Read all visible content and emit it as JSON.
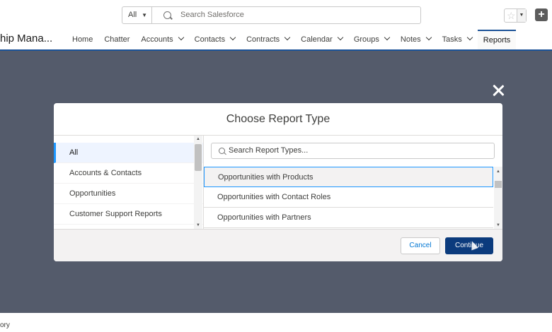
{
  "header": {
    "scope_label": "All",
    "search_placeholder": "Search Salesforce",
    "app_name": "hip Mana...",
    "nav": [
      {
        "label": "Home",
        "has_menu": false
      },
      {
        "label": "Chatter",
        "has_menu": false
      },
      {
        "label": "Accounts",
        "has_menu": true
      },
      {
        "label": "Contacts",
        "has_menu": true
      },
      {
        "label": "Contracts",
        "has_menu": true
      },
      {
        "label": "Calendar",
        "has_menu": true
      },
      {
        "label": "Groups",
        "has_menu": true
      },
      {
        "label": "Notes",
        "has_menu": true
      },
      {
        "label": "Tasks",
        "has_menu": true
      },
      {
        "label": "Reports",
        "has_menu": false
      }
    ]
  },
  "modal": {
    "title": "Choose Report Type",
    "categories": [
      "All",
      "Accounts & Contacts",
      "Opportunities",
      "Customer Support Reports"
    ],
    "search_placeholder": "Search Report Types...",
    "report_types": [
      "Opportunities with Products",
      "Opportunities with Contact Roles",
      "Opportunities with Partners"
    ],
    "cancel_label": "Cancel",
    "continue_label": "Continue"
  },
  "footer": {
    "text": "ory"
  },
  "colors": {
    "brand_blue": "#1b5297",
    "overlay": "#545b6b",
    "primary_button": "#0b3b7d",
    "selection_border": "#1b96ff"
  }
}
